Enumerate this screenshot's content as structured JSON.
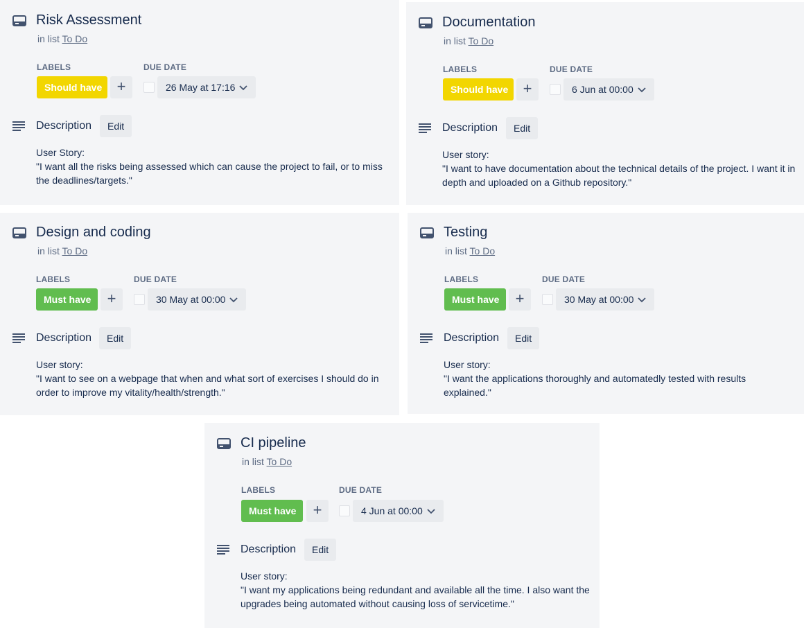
{
  "common": {
    "in_list_prefix": "in list",
    "list_name": "To Do",
    "labels_heading": "LABELS",
    "due_date_heading": "DUE DATE",
    "add_symbol": "+",
    "description_heading": "Description",
    "edit_label": "Edit"
  },
  "cards": [
    {
      "title": "Risk Assessment",
      "label": "Should have",
      "label_color": "#f2d600",
      "due": "26 May at 17:16",
      "desc_line1": "User Story:",
      "desc_line2": "\"I want all the risks being assessed which can cause the project to fail, or to miss the deadlines/targets.\""
    },
    {
      "title": "Documentation",
      "label": "Should have",
      "label_color": "#f2d600",
      "due": "6 Jun at 00:00",
      "desc_line1": "User story:",
      "desc_line2": "\"I want to have documentation about the technical details of the project. I want it in depth and uploaded on a Github repository.\""
    },
    {
      "title": "Design and coding",
      "label": "Must have",
      "label_color": "#61bd4f",
      "due": "30 May at 00:00",
      "desc_line1": "User story:",
      "desc_line2": "\"I want to see on a webpage that when and what sort of exercises I should do in order to improve my vitality/health/strength.\""
    },
    {
      "title": "Testing",
      "label": "Must have",
      "label_color": "#61bd4f",
      "due": "30 May at 00:00",
      "desc_line1": "User story:",
      "desc_line2": "\"I want the applications thoroughly and automatedly tested with results explained.\""
    },
    {
      "title": "CI pipeline",
      "label": "Must have",
      "label_color": "#61bd4f",
      "due": "4 Jun at 00:00",
      "desc_line1": "User story:",
      "desc_line2": "\"I want my applications being redundant and available all the time. I also want the upgrades being automated without causing loss of servicetime.\""
    }
  ]
}
